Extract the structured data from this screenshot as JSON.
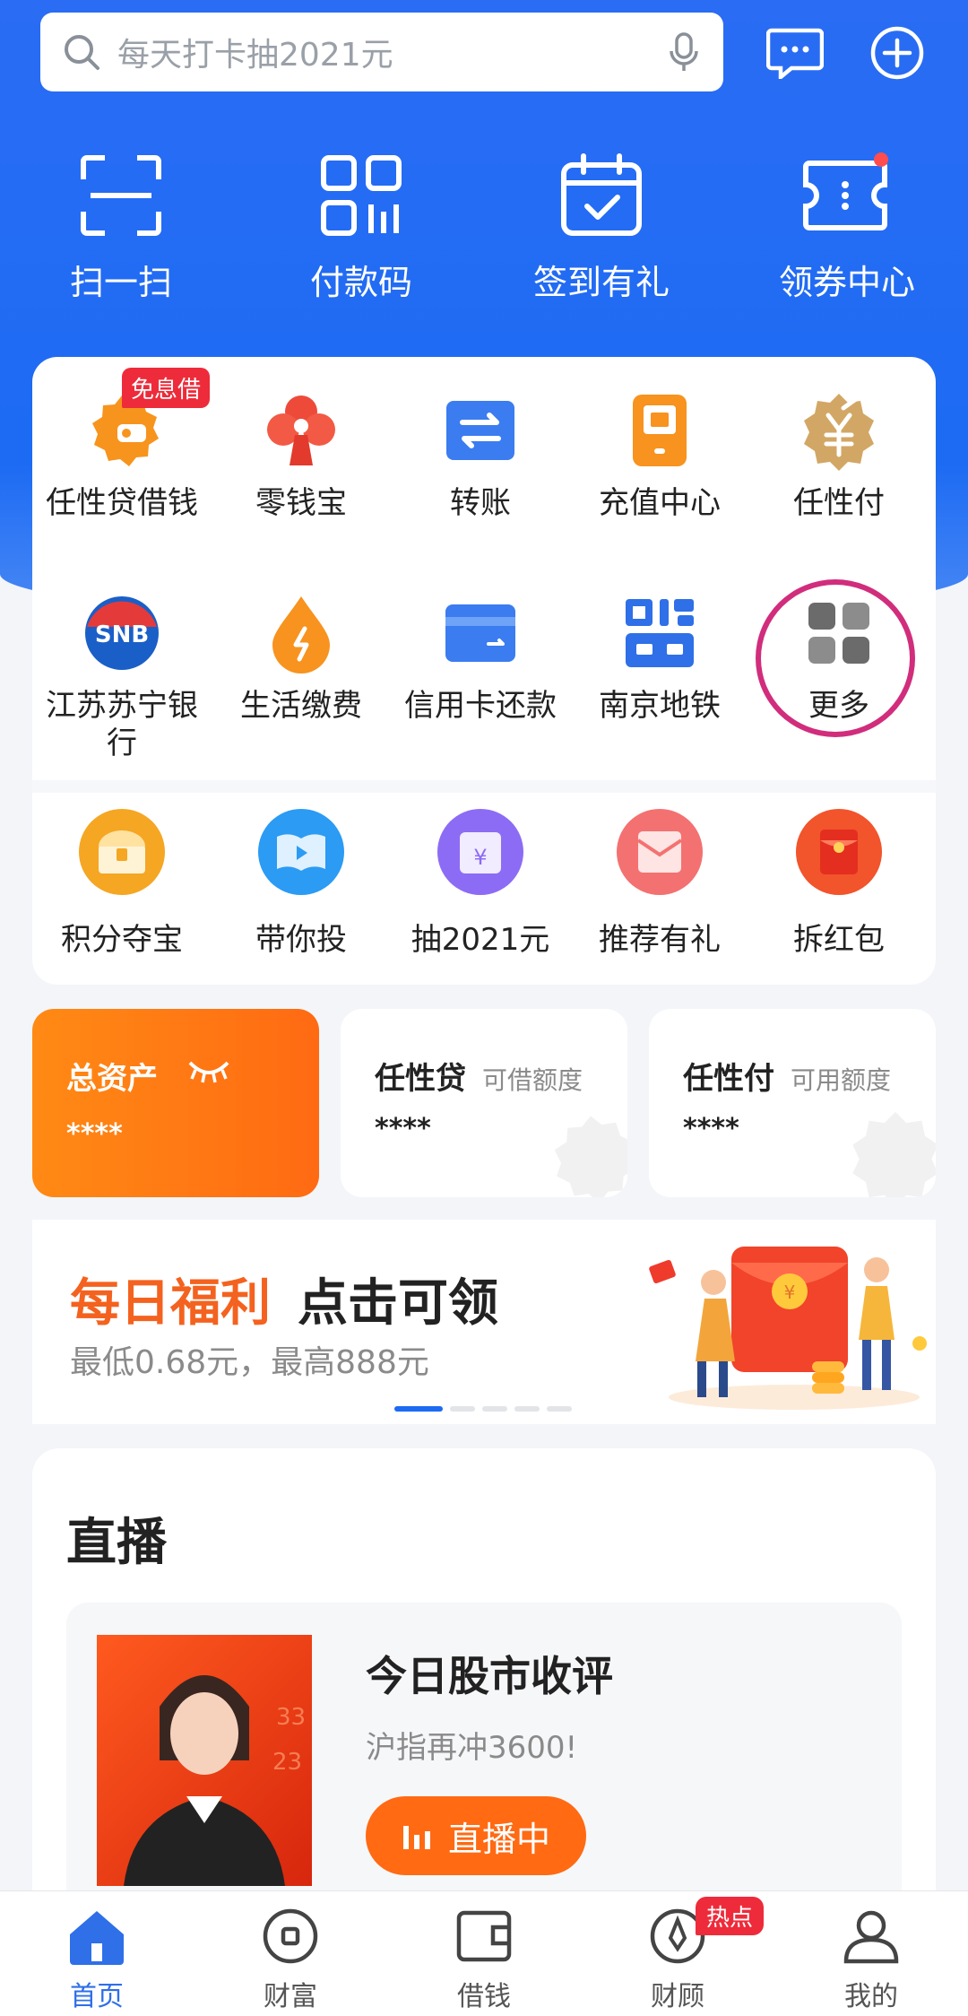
{
  "search": {
    "placeholder": "每天打卡抽2021元"
  },
  "quick_actions": [
    {
      "label": "扫一扫",
      "icon": "scan-icon"
    },
    {
      "label": "付款码",
      "icon": "payment-code-icon"
    },
    {
      "label": "签到有礼",
      "icon": "checkin-icon"
    },
    {
      "label": "领券中心",
      "icon": "coupon-icon"
    }
  ],
  "services": [
    {
      "label": "任性贷借钱",
      "badge": "免息借",
      "icon": "loan-icon"
    },
    {
      "label": "零钱宝",
      "icon": "wallet-clover-icon"
    },
    {
      "label": "转账",
      "icon": "transfer-icon"
    },
    {
      "label": "充值中心",
      "icon": "phone-recharge-icon"
    },
    {
      "label": "任性付",
      "icon": "yuan-badge-icon"
    },
    {
      "label": "江苏苏宁银行",
      "icon": "snb-logo-icon"
    },
    {
      "label": "生活缴费",
      "icon": "bill-drop-icon"
    },
    {
      "label": "信用卡还款",
      "icon": "credit-card-icon"
    },
    {
      "label": "南京地铁",
      "icon": "metro-qr-icon"
    },
    {
      "label": "更多",
      "icon": "more-grid-icon"
    }
  ],
  "promos": [
    {
      "label": "积分夺宝",
      "icon": "treasure-chest-icon",
      "color": "#f5a623"
    },
    {
      "label": "带你投",
      "icon": "video-book-icon",
      "color": "#2b9bf4"
    },
    {
      "label": "抽2021元",
      "icon": "lottery-icon",
      "color": "#8c6cf4"
    },
    {
      "label": "推荐有礼",
      "icon": "envelope-icon",
      "color": "#f47171"
    },
    {
      "label": "拆红包",
      "icon": "red-packet-icon",
      "color": "#f2542b"
    }
  ],
  "assets": {
    "total": {
      "title": "总资产",
      "value": "****"
    },
    "loan": {
      "title": "任性贷",
      "sub": "可借额度",
      "value": "****"
    },
    "pay": {
      "title": "任性付",
      "sub": "可用额度",
      "value": "****"
    }
  },
  "banner": {
    "title_orange": "每日福利",
    "title_dark": "点击可领",
    "subtitle": "最低0.68元，最高888元"
  },
  "live": {
    "section_title": "直播",
    "headline": "今日股市收评",
    "sub": "沪指再冲3600!",
    "button": "直播中"
  },
  "nav": [
    {
      "label": "首页",
      "icon": "home-icon",
      "active": true
    },
    {
      "label": "财富",
      "icon": "wealth-icon"
    },
    {
      "label": "借钱",
      "icon": "borrow-wallet-icon"
    },
    {
      "label": "财顾",
      "icon": "advisor-icon",
      "badge": "热点"
    },
    {
      "label": "我的",
      "icon": "profile-icon"
    }
  ],
  "colors": {
    "brand_blue": "#1d6bf3",
    "accent_orange": "#ff6a13",
    "highlight_circle": "#d12d7c"
  }
}
